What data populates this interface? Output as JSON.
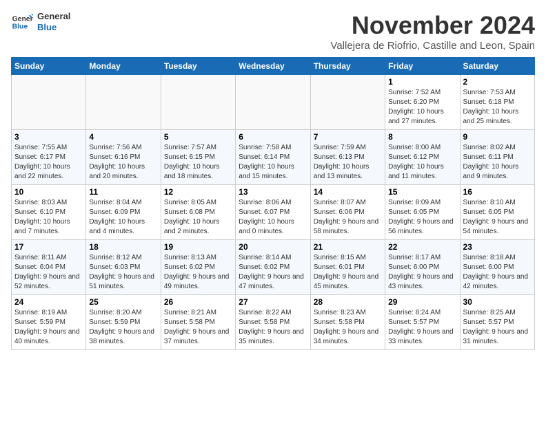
{
  "logo": {
    "line1": "General",
    "line2": "Blue"
  },
  "header": {
    "month": "November 2024",
    "location": "Vallejera de Riofrio, Castille and Leon, Spain"
  },
  "weekdays": [
    "Sunday",
    "Monday",
    "Tuesday",
    "Wednesday",
    "Thursday",
    "Friday",
    "Saturday"
  ],
  "weeks": [
    [
      {
        "day": "",
        "info": ""
      },
      {
        "day": "",
        "info": ""
      },
      {
        "day": "",
        "info": ""
      },
      {
        "day": "",
        "info": ""
      },
      {
        "day": "",
        "info": ""
      },
      {
        "day": "1",
        "info": "Sunrise: 7:52 AM\nSunset: 6:20 PM\nDaylight: 10 hours and 27 minutes."
      },
      {
        "day": "2",
        "info": "Sunrise: 7:53 AM\nSunset: 6:18 PM\nDaylight: 10 hours and 25 minutes."
      }
    ],
    [
      {
        "day": "3",
        "info": "Sunrise: 7:55 AM\nSunset: 6:17 PM\nDaylight: 10 hours and 22 minutes."
      },
      {
        "day": "4",
        "info": "Sunrise: 7:56 AM\nSunset: 6:16 PM\nDaylight: 10 hours and 20 minutes."
      },
      {
        "day": "5",
        "info": "Sunrise: 7:57 AM\nSunset: 6:15 PM\nDaylight: 10 hours and 18 minutes."
      },
      {
        "day": "6",
        "info": "Sunrise: 7:58 AM\nSunset: 6:14 PM\nDaylight: 10 hours and 15 minutes."
      },
      {
        "day": "7",
        "info": "Sunrise: 7:59 AM\nSunset: 6:13 PM\nDaylight: 10 hours and 13 minutes."
      },
      {
        "day": "8",
        "info": "Sunrise: 8:00 AM\nSunset: 6:12 PM\nDaylight: 10 hours and 11 minutes."
      },
      {
        "day": "9",
        "info": "Sunrise: 8:02 AM\nSunset: 6:11 PM\nDaylight: 10 hours and 9 minutes."
      }
    ],
    [
      {
        "day": "10",
        "info": "Sunrise: 8:03 AM\nSunset: 6:10 PM\nDaylight: 10 hours and 7 minutes."
      },
      {
        "day": "11",
        "info": "Sunrise: 8:04 AM\nSunset: 6:09 PM\nDaylight: 10 hours and 4 minutes."
      },
      {
        "day": "12",
        "info": "Sunrise: 8:05 AM\nSunset: 6:08 PM\nDaylight: 10 hours and 2 minutes."
      },
      {
        "day": "13",
        "info": "Sunrise: 8:06 AM\nSunset: 6:07 PM\nDaylight: 10 hours and 0 minutes."
      },
      {
        "day": "14",
        "info": "Sunrise: 8:07 AM\nSunset: 6:06 PM\nDaylight: 9 hours and 58 minutes."
      },
      {
        "day": "15",
        "info": "Sunrise: 8:09 AM\nSunset: 6:05 PM\nDaylight: 9 hours and 56 minutes."
      },
      {
        "day": "16",
        "info": "Sunrise: 8:10 AM\nSunset: 6:05 PM\nDaylight: 9 hours and 54 minutes."
      }
    ],
    [
      {
        "day": "17",
        "info": "Sunrise: 8:11 AM\nSunset: 6:04 PM\nDaylight: 9 hours and 52 minutes."
      },
      {
        "day": "18",
        "info": "Sunrise: 8:12 AM\nSunset: 6:03 PM\nDaylight: 9 hours and 51 minutes."
      },
      {
        "day": "19",
        "info": "Sunrise: 8:13 AM\nSunset: 6:02 PM\nDaylight: 9 hours and 49 minutes."
      },
      {
        "day": "20",
        "info": "Sunrise: 8:14 AM\nSunset: 6:02 PM\nDaylight: 9 hours and 47 minutes."
      },
      {
        "day": "21",
        "info": "Sunrise: 8:15 AM\nSunset: 6:01 PM\nDaylight: 9 hours and 45 minutes."
      },
      {
        "day": "22",
        "info": "Sunrise: 8:17 AM\nSunset: 6:00 PM\nDaylight: 9 hours and 43 minutes."
      },
      {
        "day": "23",
        "info": "Sunrise: 8:18 AM\nSunset: 6:00 PM\nDaylight: 9 hours and 42 minutes."
      }
    ],
    [
      {
        "day": "24",
        "info": "Sunrise: 8:19 AM\nSunset: 5:59 PM\nDaylight: 9 hours and 40 minutes."
      },
      {
        "day": "25",
        "info": "Sunrise: 8:20 AM\nSunset: 5:59 PM\nDaylight: 9 hours and 38 minutes."
      },
      {
        "day": "26",
        "info": "Sunrise: 8:21 AM\nSunset: 5:58 PM\nDaylight: 9 hours and 37 minutes."
      },
      {
        "day": "27",
        "info": "Sunrise: 8:22 AM\nSunset: 5:58 PM\nDaylight: 9 hours and 35 minutes."
      },
      {
        "day": "28",
        "info": "Sunrise: 8:23 AM\nSunset: 5:58 PM\nDaylight: 9 hours and 34 minutes."
      },
      {
        "day": "29",
        "info": "Sunrise: 8:24 AM\nSunset: 5:57 PM\nDaylight: 9 hours and 33 minutes."
      },
      {
        "day": "30",
        "info": "Sunrise: 8:25 AM\nSunset: 5:57 PM\nDaylight: 9 hours and 31 minutes."
      }
    ]
  ]
}
